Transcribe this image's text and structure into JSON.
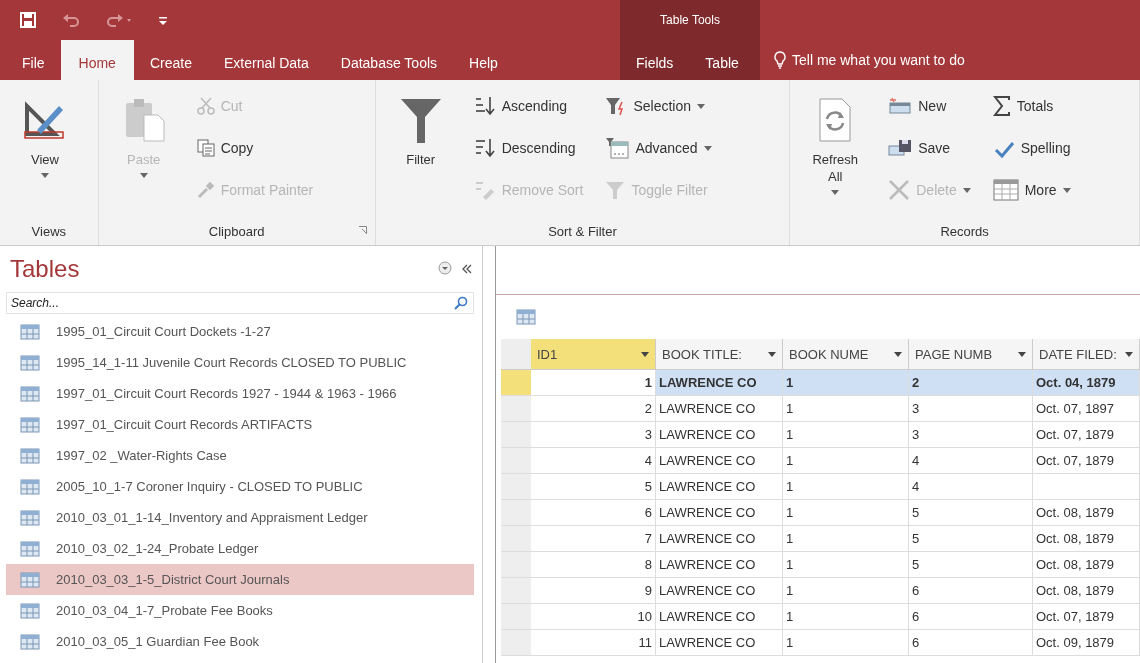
{
  "title_bar": {
    "context_title": "Table Tools"
  },
  "tabs": [
    {
      "label": "File",
      "selected": false,
      "kind": "main"
    },
    {
      "label": "Home",
      "selected": true,
      "kind": "main"
    },
    {
      "label": "Create",
      "selected": false,
      "kind": "main"
    },
    {
      "label": "External Data",
      "selected": false,
      "kind": "main"
    },
    {
      "label": "Database Tools",
      "selected": false,
      "kind": "main"
    },
    {
      "label": "Help",
      "selected": false,
      "kind": "main"
    },
    {
      "label": "Fields",
      "selected": false,
      "kind": "context"
    },
    {
      "label": "Table",
      "selected": false,
      "kind": "context"
    }
  ],
  "tell_me": "Tell me what you want to do",
  "ribbon": [
    {
      "label": "Views",
      "launcher": false,
      "columns": [
        [
          {
            "label": "View",
            "kind": "large",
            "disabled": false,
            "dropdown": true
          }
        ]
      ]
    },
    {
      "label": "Clipboard",
      "launcher": true,
      "columns": [
        [
          {
            "label": "Paste",
            "kind": "large",
            "disabled": true,
            "dropdown": true
          }
        ],
        [
          {
            "label": "Cut",
            "kind": "small",
            "disabled": true,
            "dropdown": false
          },
          {
            "label": "Copy",
            "kind": "small",
            "disabled": false,
            "dropdown": false
          },
          {
            "label": "Format Painter",
            "kind": "small",
            "disabled": true,
            "dropdown": false
          }
        ]
      ]
    },
    {
      "label": "Sort & Filter",
      "launcher": false,
      "columns": [
        [
          {
            "label": "Filter",
            "kind": "large",
            "disabled": false,
            "dropdown": false
          }
        ],
        [
          {
            "label": "Ascending",
            "kind": "small",
            "disabled": false,
            "dropdown": false
          },
          {
            "label": "Descending",
            "kind": "small",
            "disabled": false,
            "dropdown": false
          },
          {
            "label": "Remove Sort",
            "kind": "small",
            "disabled": true,
            "dropdown": false
          }
        ],
        [
          {
            "label": "Selection",
            "kind": "small",
            "disabled": false,
            "dropdown": true
          },
          {
            "label": "Advanced",
            "kind": "small",
            "disabled": false,
            "dropdown": true
          },
          {
            "label": "Toggle Filter",
            "kind": "small",
            "disabled": true,
            "dropdown": false
          }
        ]
      ]
    },
    {
      "label": "Records",
      "launcher": false,
      "columns": [
        [
          {
            "label": "Refresh All",
            "kind": "large",
            "disabled": false,
            "dropdown": true
          }
        ],
        [
          {
            "label": "New",
            "kind": "small",
            "disabled": false,
            "dropdown": false
          },
          {
            "label": "Save",
            "kind": "small",
            "disabled": false,
            "dropdown": false
          },
          {
            "label": "Delete",
            "kind": "small",
            "disabled": true,
            "dropdown": true
          }
        ],
        [
          {
            "label": "Totals",
            "kind": "small",
            "disabled": false,
            "dropdown": false
          },
          {
            "label": "Spelling",
            "kind": "small",
            "disabled": false,
            "dropdown": false
          },
          {
            "label": "More",
            "kind": "small",
            "disabled": false,
            "dropdown": true
          }
        ]
      ]
    }
  ],
  "nav_pane": {
    "title": "Tables",
    "search": {
      "placeholder": "Search..."
    },
    "items": [
      {
        "label": "1995_01_Circuit Court Dockets -1-27",
        "selected": false
      },
      {
        "label": "1995_14_1-11 Juvenile Court Records CLOSED TO PUBLIC",
        "selected": false
      },
      {
        "label": "1997_01_Circuit Court Records 1927 - 1944 & 1963 - 1966",
        "selected": false
      },
      {
        "label": "1997_01_Circuit Court Records ARTIFACTS",
        "selected": false
      },
      {
        "label": "1997_02 _Water-Rights Case",
        "selected": false
      },
      {
        "label": "2005_10_1-7 Coroner Inquiry - CLOSED TO PUBLIC",
        "selected": false
      },
      {
        "label": "2010_03_01_1-14_Inventory and Appraisment Ledger",
        "selected": false
      },
      {
        "label": "2010_03_02_1-24_Probate Ledger",
        "selected": false
      },
      {
        "label": "2010_03_03_1-5_District Court Journals",
        "selected": true
      },
      {
        "label": "2010_03_04_1-7_Probate Fee Books",
        "selected": false
      },
      {
        "label": "2010_03_05_1 Guardian Fee Book",
        "selected": false
      }
    ]
  },
  "table": {
    "columns": [
      {
        "label": "ID1",
        "active": true
      },
      {
        "label": "BOOK TITLE:",
        "active": false
      },
      {
        "label": "BOOK NUME",
        "active": false
      },
      {
        "label": "PAGE NUMB",
        "active": false
      },
      {
        "label": "DATE FILED:",
        "active": false
      }
    ],
    "rows": [
      {
        "selected": true,
        "cells": [
          "1",
          "LAWRENCE CO",
          "1",
          "2",
          "Oct. 04, 1879"
        ]
      },
      {
        "selected": false,
        "cells": [
          "2",
          "LAWRENCE CO",
          "1",
          "3",
          "Oct. 07, 1897"
        ]
      },
      {
        "selected": false,
        "cells": [
          "3",
          "LAWRENCE CO",
          "1",
          "3",
          "Oct. 07, 1879"
        ]
      },
      {
        "selected": false,
        "cells": [
          "4",
          "LAWRENCE CO",
          "1",
          "4",
          "Oct. 07, 1879"
        ]
      },
      {
        "selected": false,
        "cells": [
          "5",
          "LAWRENCE CO",
          "1",
          "4",
          ""
        ]
      },
      {
        "selected": false,
        "cells": [
          "6",
          "LAWRENCE CO",
          "1",
          "5",
          "Oct. 08, 1879"
        ]
      },
      {
        "selected": false,
        "cells": [
          "7",
          "LAWRENCE CO",
          "1",
          "5",
          "Oct. 08, 1879"
        ]
      },
      {
        "selected": false,
        "cells": [
          "8",
          "LAWRENCE CO",
          "1",
          "5",
          "Oct. 08, 1879"
        ]
      },
      {
        "selected": false,
        "cells": [
          "9",
          "LAWRENCE CO",
          "1",
          "6",
          "Oct. 08, 1879"
        ]
      },
      {
        "selected": false,
        "cells": [
          "10",
          "LAWRENCE CO",
          "1",
          "6",
          "Oct. 07, 1879"
        ]
      },
      {
        "selected": false,
        "cells": [
          "11",
          "LAWRENCE CO",
          "1",
          "6",
          "Oct. 09, 1879"
        ]
      }
    ]
  }
}
